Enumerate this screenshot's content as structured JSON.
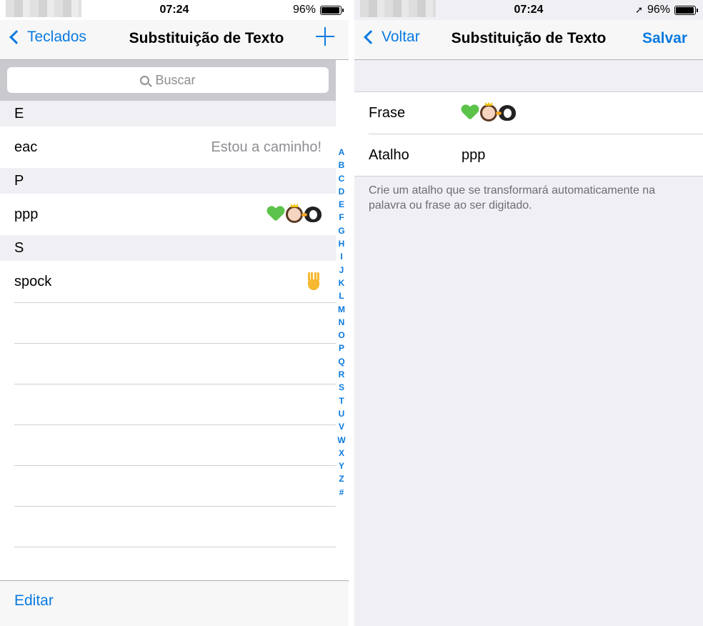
{
  "status_bar": {
    "time": "07:24",
    "battery": "96%",
    "battery_level": 0.96
  },
  "left": {
    "nav": {
      "back_label": "Teclados",
      "title": "Substituição de Texto"
    },
    "search": {
      "placeholder": "Buscar"
    },
    "sections": [
      {
        "header": "E",
        "rows": [
          {
            "shortcut": "eac",
            "phrase": "Estou a caminho!"
          }
        ]
      },
      {
        "header": "P",
        "rows": [
          {
            "shortcut": "ppp",
            "phrase_icons": [
              "green-heart-icon",
              "princess-icon",
              "penguin-icon"
            ]
          }
        ]
      },
      {
        "header": "S",
        "rows": [
          {
            "shortcut": "spock",
            "phrase_icons": [
              "vulcan-salute-icon"
            ]
          }
        ]
      }
    ],
    "index_letters": [
      "A",
      "B",
      "C",
      "D",
      "E",
      "F",
      "G",
      "H",
      "I",
      "J",
      "K",
      "L",
      "M",
      "N",
      "O",
      "P",
      "Q",
      "R",
      "S",
      "T",
      "U",
      "V",
      "W",
      "X",
      "Y",
      "Z",
      "#"
    ],
    "toolbar": {
      "edit_label": "Editar"
    }
  },
  "right": {
    "nav": {
      "back_label": "Voltar",
      "title": "Substituição de Texto",
      "save_label": "Salvar"
    },
    "form": {
      "phrase_label": "Frase",
      "phrase_icons": [
        "green-heart-icon",
        "princess-icon",
        "penguin-icon"
      ],
      "shortcut_label": "Atalho",
      "shortcut_value": "ppp"
    },
    "help_text": "Crie um atalho que se transformará automaticamente na palavra ou frase ao ser digitado."
  },
  "colors": {
    "accent": "#0a7ae0",
    "section_bg": "#efeff4",
    "secondary_text": "#8e8e93"
  }
}
